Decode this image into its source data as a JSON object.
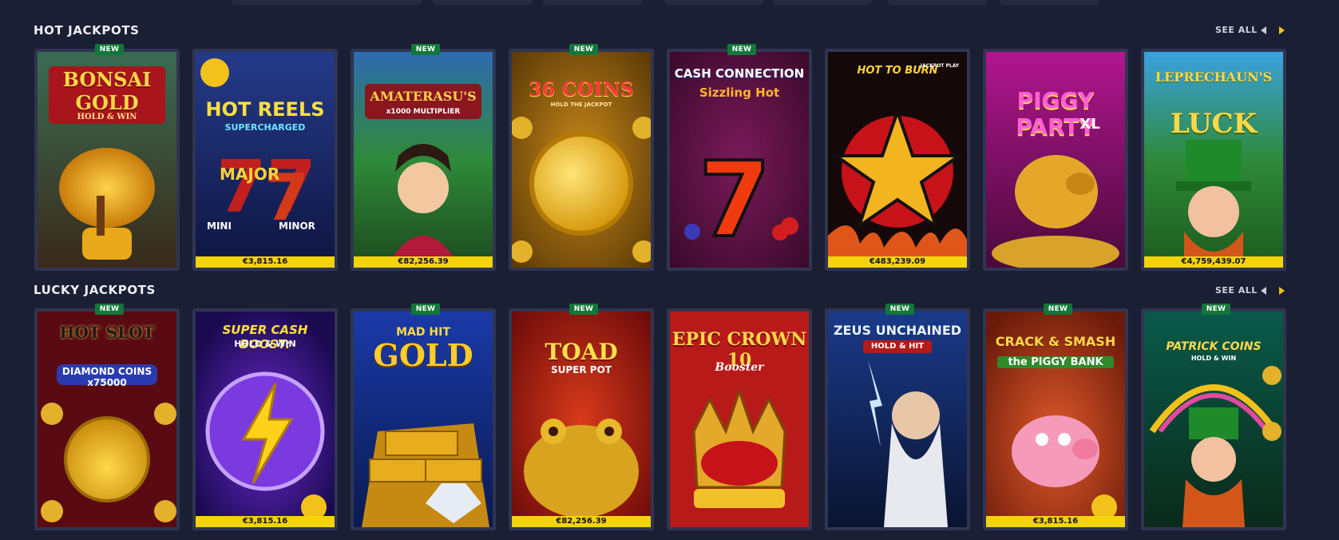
{
  "top_tabs_count": 8,
  "sections": [
    {
      "title": "HOT JACKPOTS",
      "see_all": "SEE ALL",
      "games": [
        {
          "name": "BONSAI GOLD",
          "sub": "HOLD & WIN",
          "new": true,
          "jackpot": ""
        },
        {
          "name": "HOT REELS",
          "sub": "SUPERCHARGED",
          "new": false,
          "jackpot": "€3,815.16"
        },
        {
          "name": "AMATERASU'S",
          "sub": "x1000 MULTIPLIER",
          "new": true,
          "jackpot": "€82,256.39"
        },
        {
          "name": "36 COINS",
          "sub": "HOLD THE JACKPOT",
          "new": true,
          "jackpot": ""
        },
        {
          "name": "CASH CONNECTION",
          "sub": "Sizzling Hot",
          "new": true,
          "jackpot": ""
        },
        {
          "name": "HOT TO BURN",
          "sub": "JACKPOT PLAY",
          "new": false,
          "jackpot": "€483,239.09"
        },
        {
          "name": "PIGGY PARTY",
          "sub": "XL",
          "new": false,
          "jackpot": ""
        },
        {
          "name": "LEPRECHAUN'S",
          "sub": "LUCK",
          "new": false,
          "jackpot": "€4,759,439.07"
        }
      ]
    },
    {
      "title": "LUCKY JACKPOTS",
      "see_all": "SEE ALL",
      "games": [
        {
          "name": "HOT SLOT",
          "sub": "DIAMOND COINS x75000",
          "new": true,
          "jackpot": ""
        },
        {
          "name": "SUPER CASH BOOST:",
          "sub": "HOLD & WIN",
          "new": false,
          "jackpot": "€3,815.16"
        },
        {
          "name": "MAD HIT",
          "sub": "GOLD",
          "new": true,
          "jackpot": ""
        },
        {
          "name": "TOAD",
          "sub": "SUPER POT",
          "new": true,
          "jackpot": "€82,256.39"
        },
        {
          "name": "EPIC CROWN 10",
          "sub": "Booster",
          "new": false,
          "jackpot": ""
        },
        {
          "name": "ZEUS UNCHAINED",
          "sub": "HOLD & HIT",
          "new": true,
          "jackpot": ""
        },
        {
          "name": "CRACK & SMASH",
          "sub": "the PIGGY BANK",
          "new": true,
          "jackpot": "€3,815.16"
        },
        {
          "name": "PATRICK COINS",
          "sub": "HOLD & WIN",
          "new": true,
          "jackpot": ""
        }
      ]
    }
  ],
  "icons": {
    "prev": "chevron-left-icon",
    "next": "chevron-right-icon"
  },
  "colors": {
    "background": "#1b1f33",
    "new_badge": "#14773a",
    "jackpot_bar": "#f3d40a"
  }
}
